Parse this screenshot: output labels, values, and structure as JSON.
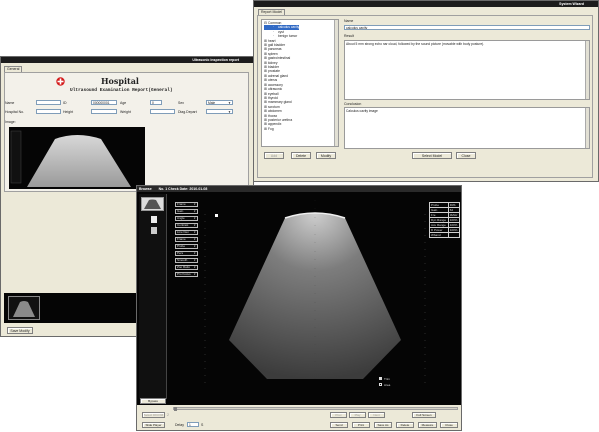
{
  "wizard": {
    "title": "System Wizard",
    "tab": "Report Model",
    "tree_items": [
      "Common",
      "calculus cavity",
      "cyst",
      "benign tumor",
      "heart",
      "gall bladder",
      "pancreas",
      "spleen",
      "gastrointestinal",
      "kidney",
      "bladder",
      "prostate",
      "adrenal gland",
      "uterus",
      "accessory",
      "ultrasonic",
      "eyeball",
      "thyroid",
      "mammary gland",
      "scrotum",
      "abdomen",
      "thorax",
      "posterior urethra",
      "appendix",
      "Fog"
    ],
    "selected_index": 1,
    "name_label": "Name",
    "name_value": "calculus cavity",
    "result_label": "Result",
    "result_text": "About 5 mm strong echo nar cloud, followed by the sound picture (movable with body posture).",
    "conclusion_label": "Conclusion",
    "conclusion_text": "Calculus cavity image",
    "buttons": {
      "add": "Add",
      "delete": "Delete",
      "modify": "Modify",
      "select_model": "Select Model",
      "close": "Close"
    }
  },
  "report": {
    "title": "Ultrasonic inspection report",
    "tab": "General",
    "hospital": "Hospital",
    "subtitle": "Ultrasound Examination Report(General)",
    "fields": {
      "name_label": "Name",
      "id_label": "ID",
      "id_value": "000000001",
      "age_label": "Age",
      "age_value": "0",
      "sex_label": "Sex",
      "sex_value": "Male",
      "hospital_no_label": "Hospital No.",
      "height_label": "Height",
      "weight_label": "Weight",
      "diag_depart_label": "Diag.Depart"
    },
    "image_label": "Image:",
    "save_modify": "Save Modify"
  },
  "imaging": {
    "title": "Browse",
    "check_date": "No. 1   Check Date: 2010-01-08",
    "left_menu": [
      "Frame",
      "Gain",
      "Angle",
      "Contrast",
      "Line Den",
      "Frame",
      "Probe",
      "Pers",
      "Smooth",
      "Zoo Ratio",
      "Pro Focus"
    ],
    "right_table": [
      [
        "Probe",
        "R3S"
      ],
      [
        "Gain",
        "64"
      ],
      [
        "Fre",
        "3MHz"
      ],
      [
        "Dyn Range",
        "100%"
      ],
      [
        "Acu Range",
        "100%"
      ],
      [
        "D Power",
        "100%"
      ],
      [
        "Wband",
        ""
      ]
    ],
    "legend_1": "Trim",
    "legend_2": "Area",
    "thumb_label": "Bypass",
    "slider_text": "PW 20",
    "controls": {
      "select_dicom": "Select DICOM",
      "count": "2",
      "prev": "Prev",
      "play": "Play",
      "next": "Next",
      "full_screen": "Full Screen",
      "slide_player": "Slide Player",
      "delay_label": "Delay",
      "delay_value": "1",
      "delay_unit": "S",
      "send": "Send",
      "print": "Print",
      "save_as": "Save As",
      "delete": "Delete",
      "measure": "Measure",
      "close": "Close"
    }
  },
  "colors": {
    "window_bg": "#ece9d8",
    "titlebar": "#1c1c1c",
    "select": "#316ac5",
    "logo_red": "#d41a1a"
  }
}
